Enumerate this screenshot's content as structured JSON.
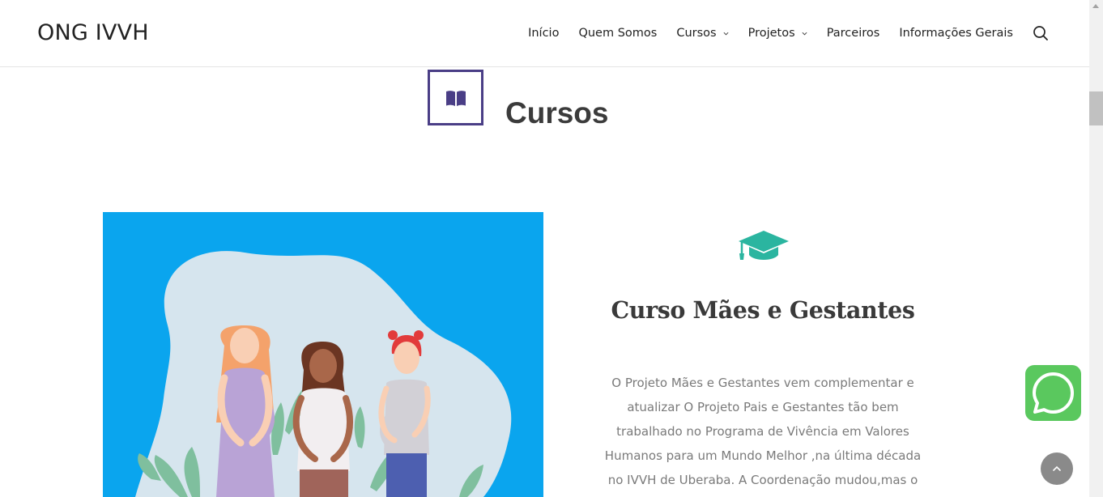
{
  "header": {
    "logo": "ONG IVVH",
    "nav": [
      {
        "label": "Início",
        "dropdown": false
      },
      {
        "label": "Quem Somos",
        "dropdown": false
      },
      {
        "label": "Cursos",
        "dropdown": true
      },
      {
        "label": "Projetos",
        "dropdown": true
      },
      {
        "label": "Parceiros",
        "dropdown": false
      },
      {
        "label": "Informações Gerais",
        "dropdown": false
      }
    ],
    "search_icon": "search-icon"
  },
  "section": {
    "title": "Cursos",
    "icon": "book-icon",
    "icon_color": "#4a3e86"
  },
  "course": {
    "icon": "graduation-cap-icon",
    "icon_color": "#2bb5a0",
    "title": "Curso Mães e Gestantes",
    "description": "O Projeto Mães e Gestantes vem complementar e atualizar O Projeto Pais e Gestantes tão bem trabalhado no Programa de Vivência em Valores Humanos para um Mundo Melhor ,na última década no IVVH de Uberaba. A Coordenação mudou,mas o",
    "image_bg": "#0aa5ee"
  },
  "floating": {
    "whatsapp_icon": "whatsapp-icon",
    "whatsapp_color": "#5ac85e",
    "back_to_top_icon": "chevron-up-icon"
  }
}
